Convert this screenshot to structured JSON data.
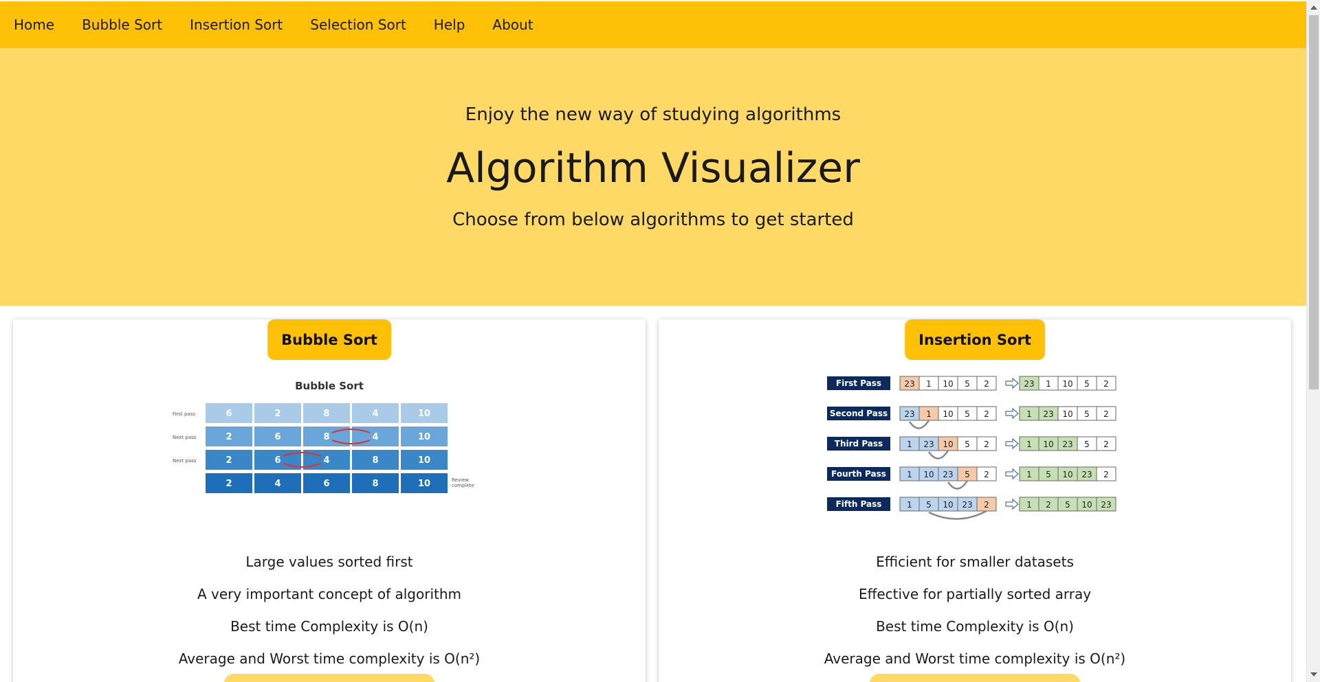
{
  "nav": {
    "items": [
      "Home",
      "Bubble Sort",
      "Insertion Sort",
      "Selection Sort",
      "Help",
      "About"
    ]
  },
  "hero": {
    "tagline": "Enjoy the new way of studying algorithms",
    "title": "Algorithm Visualizer",
    "subtitle": "Choose from below algorithms to get started"
  },
  "cards": [
    {
      "button": "Bubble Sort",
      "image": {
        "title": "Bubble Sort",
        "rows": [
          {
            "label": "First pass",
            "values": [
              "6",
              "2",
              "8",
              "4",
              "10"
            ]
          },
          {
            "label": "Next pass",
            "values": [
              "2",
              "6",
              "8",
              "4",
              "10"
            ]
          },
          {
            "label": "Next pass",
            "values": [
              "2",
              "6",
              "4",
              "8",
              "10"
            ]
          },
          {
            "label": "",
            "values": [
              "2",
              "4",
              "6",
              "8",
              "10"
            ]
          }
        ],
        "complete_label": "Review complete",
        "colors": [
          "#a9cbe8",
          "#6aa6d9",
          "#3a87c8",
          "#1f6fb8"
        ]
      },
      "lines": [
        "Large values sorted first",
        "A very important concept of algorithm",
        "Best time Complexity is O(n)",
        "Average and Worst time complexity is O(n²)"
      ]
    },
    {
      "button": "Insertion Sort",
      "image": {
        "passes": [
          {
            "label": "First Pass",
            "before": [
              "23",
              "1",
              "10",
              "5",
              "2"
            ],
            "after": [
              "23",
              "1",
              "10",
              "5",
              "2"
            ]
          },
          {
            "label": "Second Pass",
            "before": [
              "23",
              "1",
              "10",
              "5",
              "2"
            ],
            "after": [
              "1",
              "23",
              "10",
              "5",
              "2"
            ]
          },
          {
            "label": "Third Pass",
            "before": [
              "1",
              "23",
              "10",
              "5",
              "2"
            ],
            "after": [
              "1",
              "10",
              "23",
              "5",
              "2"
            ]
          },
          {
            "label": "Fourth Pass",
            "before": [
              "1",
              "10",
              "23",
              "5",
              "2"
            ],
            "after": [
              "1",
              "5",
              "10",
              "23",
              "2"
            ]
          },
          {
            "label": "Fifth Pass",
            "before": [
              "1",
              "5",
              "10",
              "23",
              "2"
            ],
            "after": [
              "1",
              "2",
              "5",
              "10",
              "23"
            ]
          }
        ],
        "colors": {
          "label_bg": "#0d2a5e",
          "key": "#f6c9a8",
          "sorted": "#bcd5ee",
          "result": "#c6e0b4"
        }
      },
      "lines": [
        "Efficient for smaller datasets",
        "Effective for partially sorted array",
        "Best time Complexity is O(n)",
        "Average and Worst time complexity is O(n²)"
      ]
    }
  ]
}
